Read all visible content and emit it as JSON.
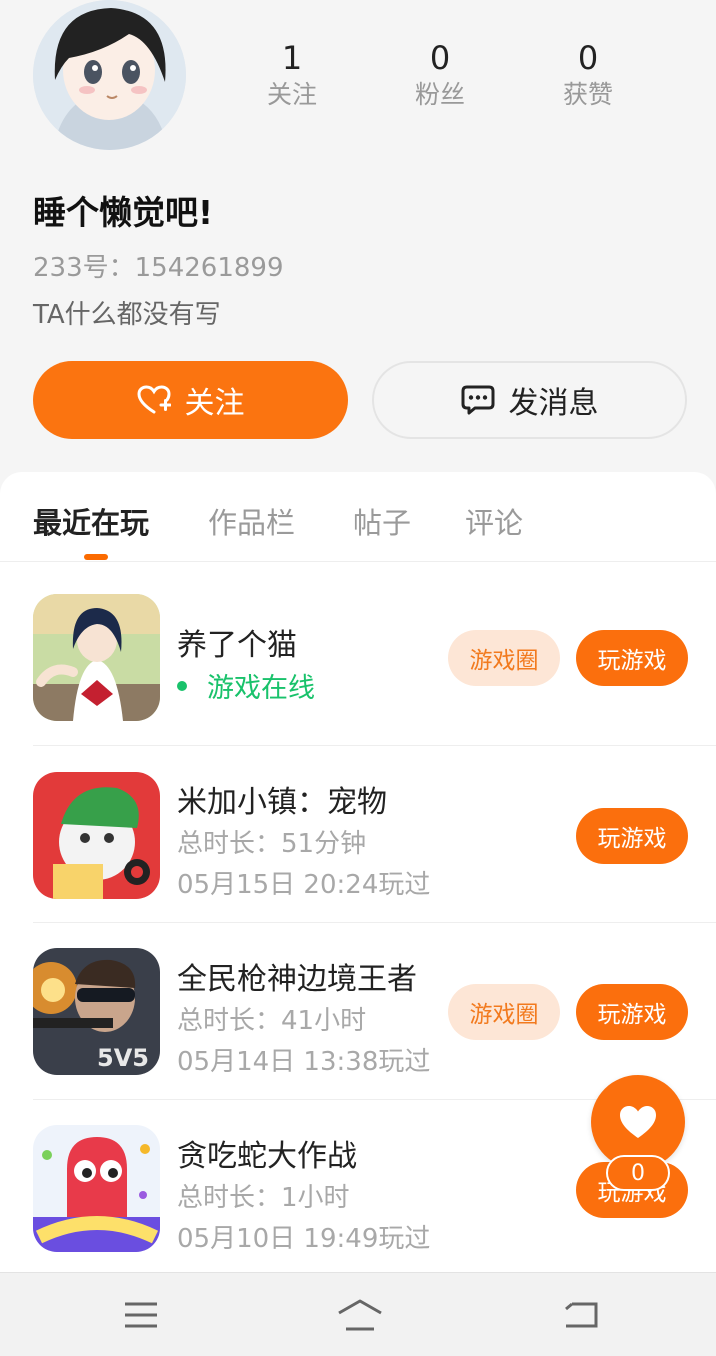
{
  "profile": {
    "nickname": "睡个懒觉吧!",
    "uid": "233号：154261899",
    "bio": "TA什么都没有写",
    "stats": [
      {
        "value": "1",
        "label": "关注"
      },
      {
        "value": "0",
        "label": "粉丝"
      },
      {
        "value": "0",
        "label": "获赞"
      }
    ],
    "follow_label": "关注",
    "message_label": "发消息"
  },
  "tabs": [
    "最近在玩",
    "作品栏",
    "帖子",
    "评论"
  ],
  "games": [
    {
      "name": "养了个猫",
      "status": "游戏在线",
      "circle_label": "游戏圈",
      "play_label": "玩游戏"
    },
    {
      "name": "米加小镇：宠物",
      "duration": "总时长：51分钟",
      "last_played": "05月15日 20:24玩过",
      "play_label": "玩游戏"
    },
    {
      "name": "全民枪神边境王者",
      "duration": "总时长：41小时",
      "last_played": "05月14日 13:38玩过",
      "circle_label": "游戏圈",
      "play_label": "玩游戏"
    },
    {
      "name": "贪吃蛇大作战",
      "duration": "总时长：1小时",
      "last_played": "05月10日 19:49玩过",
      "play_label": "玩游戏"
    }
  ],
  "fab": {
    "count": "0"
  },
  "colors": {
    "accent": "#fb6f0d",
    "online": "#19c26b",
    "circle_bg": "#fde6d6"
  }
}
